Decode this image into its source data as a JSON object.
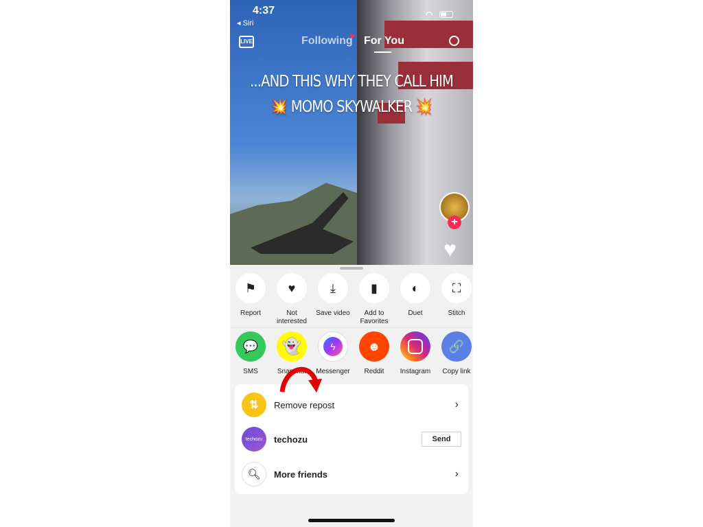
{
  "status": {
    "time": "4:37",
    "back": "◂ Siri"
  },
  "top_nav": {
    "live": "LIVE",
    "tabs": [
      {
        "label": "Following",
        "active": false,
        "has_dot": true
      },
      {
        "label": "For You",
        "active": true
      }
    ]
  },
  "video": {
    "caption_line1": "...AND THIS WHY THEY CALL HIM",
    "caption_line2": "💥 MOMO SKYWALKER 💥"
  },
  "actions": [
    {
      "label": "Report",
      "icon": "flag-icon"
    },
    {
      "label": "Not\ninterested",
      "icon": "broken-heart-icon"
    },
    {
      "label": "Save video",
      "icon": "download-icon"
    },
    {
      "label": "Add to\nFavorites",
      "icon": "bookmark-icon"
    },
    {
      "label": "Duet",
      "icon": "duet-icon"
    },
    {
      "label": "Stitch",
      "icon": "stitch-icon"
    }
  ],
  "share": [
    {
      "label": "SMS",
      "color": "#34c759"
    },
    {
      "label": "Snapchat",
      "color": "#fffc00"
    },
    {
      "label": "Messenger",
      "color": "#ffffff"
    },
    {
      "label": "Reddit",
      "color": "#ff4500"
    },
    {
      "label": "Instagram",
      "color": "#d62976"
    },
    {
      "label": "Copy link",
      "color": "#5b7fe6"
    }
  ],
  "list": {
    "repost": "Remove repost",
    "friend": "techozu",
    "friend_avatar": "techozu",
    "send": "Send",
    "more": "More friends"
  },
  "colors": {
    "repost": "#f7c51a",
    "arrow": "#e30000",
    "accent": "#fe2c55"
  }
}
